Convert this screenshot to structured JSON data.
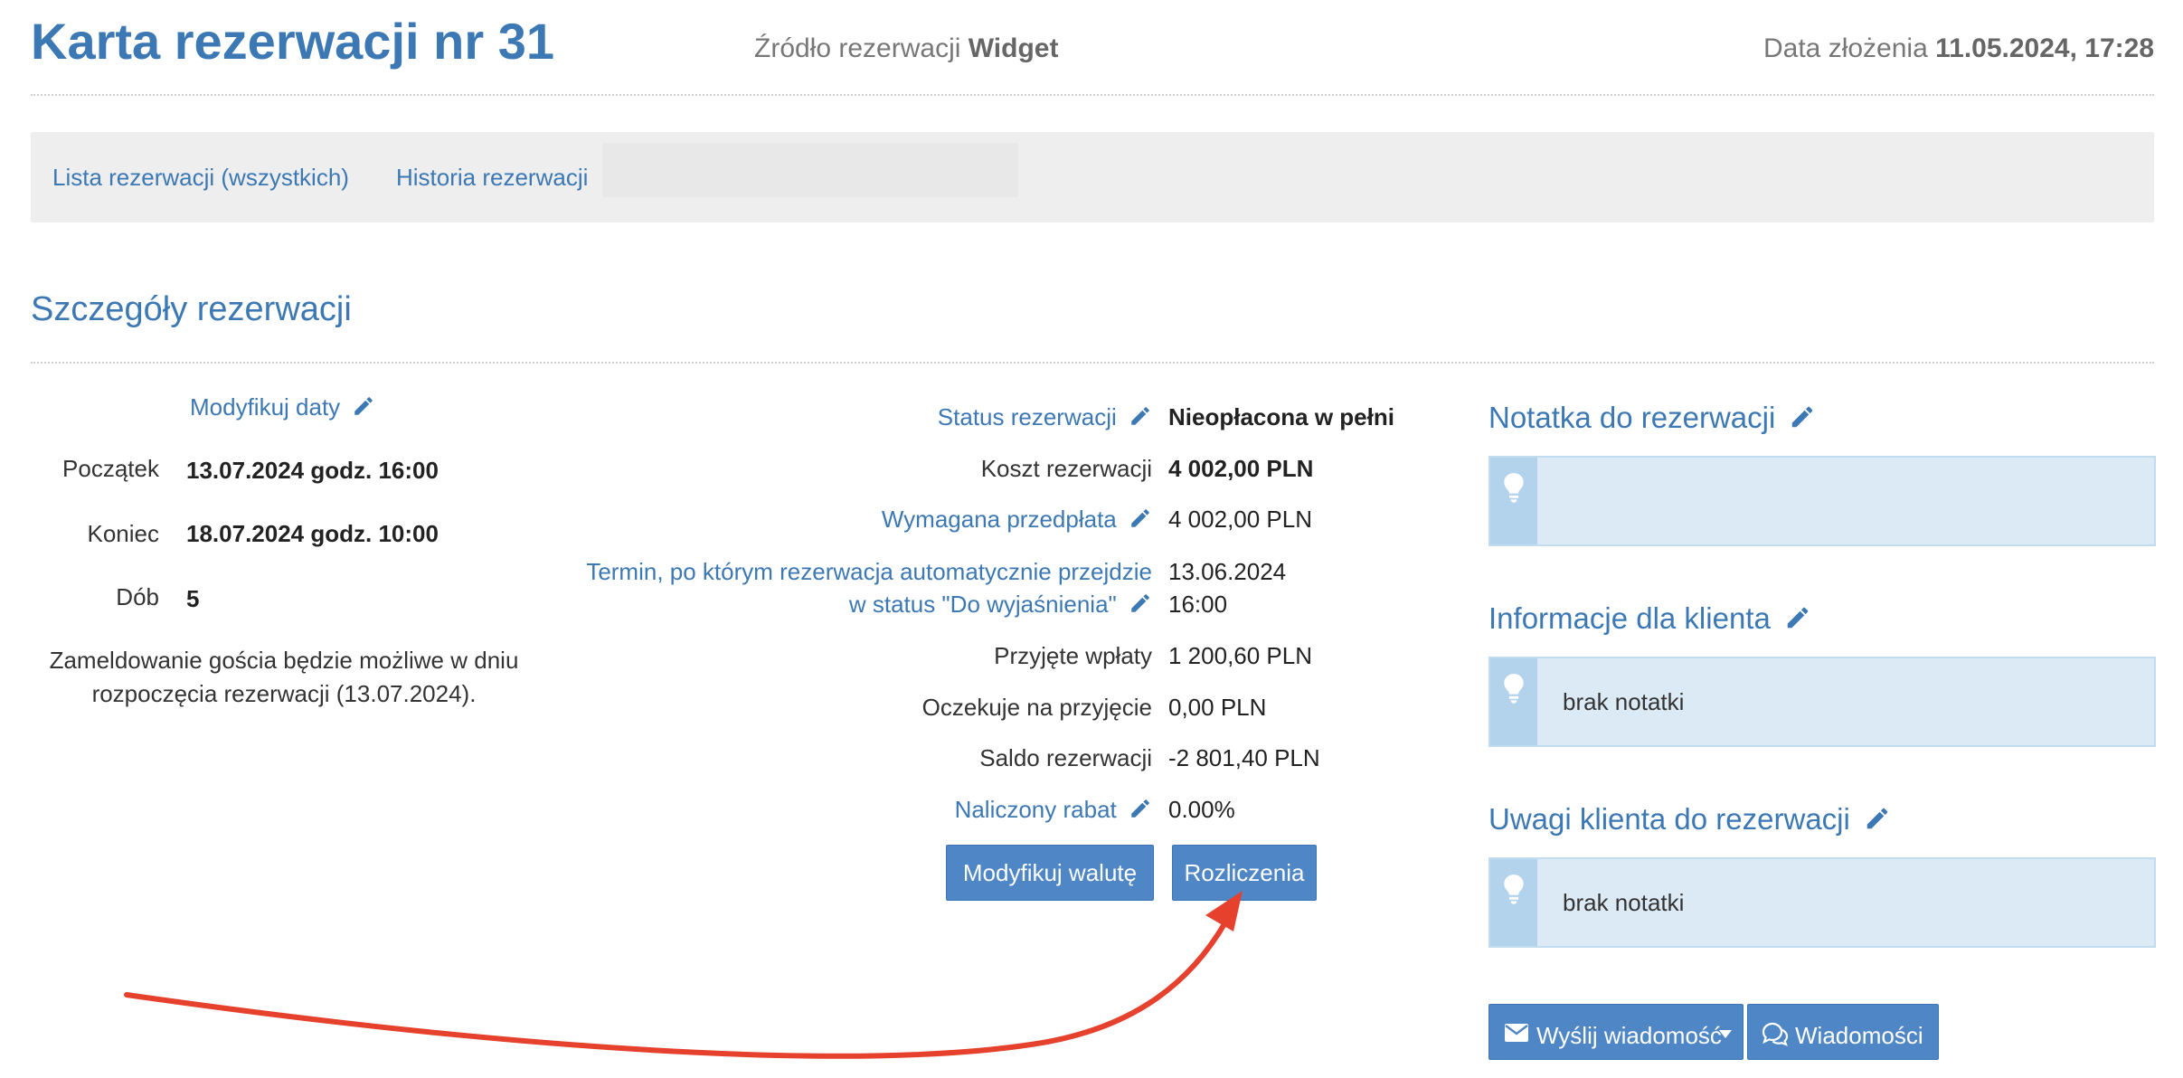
{
  "header": {
    "title": "Karta rezerwacji nr 31",
    "source_label": "Źródło rezerwacji",
    "source_value": "Widget",
    "date_label": "Data złożenia",
    "date_value": "11.05.2024, 17:28"
  },
  "nav": {
    "links": [
      "Lista rezerwacji (wszystkich)",
      "Historia rezerwacji"
    ]
  },
  "section_title": "Szczegóły rezerwacji",
  "dates": {
    "modify_label": "Modyfikuj daty",
    "start_label": "Początek",
    "start_value": "13.07.2024 godz. 16:00",
    "end_label": "Koniec",
    "end_value": "18.07.2024 godz. 10:00",
    "nights_label": "Dób",
    "nights_value": "5",
    "checkin_note": "Zameldowanie gościa będzie możliwe w dniu rozpoczęcia rezerwacji (13.07.2024)."
  },
  "details": {
    "status_label": "Status rezerwacji",
    "status_value": "Nieopłacona w pełni",
    "cost_label": "Koszt rezerwacji",
    "cost_value": "4 002,00 PLN",
    "prepay_label": "Wymagana przedpłata",
    "prepay_value": "4 002,00 PLN",
    "deadline_label_line1": "Termin, po którym rezerwacja automatycznie przejdzie",
    "deadline_label_line2": "w status \"Do wyjaśnienia\"",
    "deadline_date": "13.06.2024",
    "deadline_time": "16:00",
    "received_label": "Przyjęte wpłaty",
    "received_value": "1 200,60 PLN",
    "pending_label": "Oczekuje na przyjęcie",
    "pending_value": "0,00 PLN",
    "balance_label": "Saldo rezerwacji",
    "balance_value": "-2 801,40 PLN",
    "discount_label": "Naliczony rabat",
    "discount_value": "0.00%",
    "currency_button": "Modyfikuj walutę",
    "settlements_button": "Rozliczenia"
  },
  "notes": {
    "reservation_note_title": "Notatka do rezerwacji",
    "reservation_note_text": "",
    "client_info_title": "Informacje dla klienta",
    "client_info_text": "brak notatki",
    "client_remarks_title": "Uwagi klienta do rezerwacji",
    "client_remarks_text": "brak notatki"
  },
  "messages": {
    "send_button": "Wyślij wiadomość",
    "messages_button": "Wiadomości"
  },
  "colors": {
    "accent": "#3c78b4",
    "button": "#4f86c6",
    "note_bg": "#dceaf6",
    "annotation_arrow": "#e5412d"
  },
  "icons": [
    "pencil-icon",
    "lightbulb-icon",
    "envelope-icon",
    "caret-down-icon",
    "chat-bubbles-icon"
  ]
}
